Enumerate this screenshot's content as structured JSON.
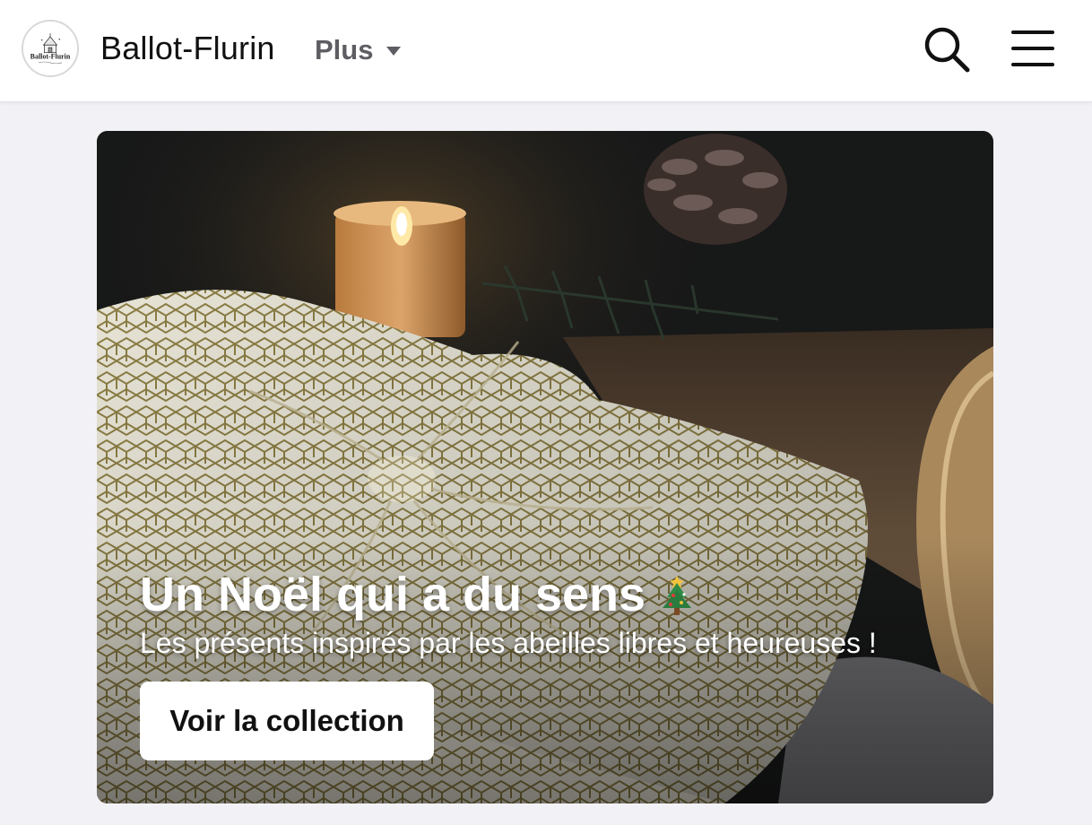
{
  "header": {
    "brand": "Ballot-Flurin",
    "logo_text": "Ballot-Flurin",
    "more_label": "Plus",
    "icons": {
      "search": "search-icon",
      "menu": "hamburger-menu-icon",
      "more": "caret-down-icon"
    }
  },
  "hero": {
    "title": "Un Noël qui a du sens",
    "title_icon": "christmas-tree-icon",
    "subtitle": "Les présents inspirés par les abeilles libres et heureuses !",
    "cta_label": "Voir la collection",
    "image_description": "gift-wrapped-in-patterned-cloth-with-candle-and-pinecone"
  },
  "colors": {
    "header_bg": "#ffffff",
    "page_bg": "#f2f2f6",
    "brand_text": "#111111",
    "more_text": "#5d5d63",
    "cta_bg": "#ffffff",
    "hero_text": "#ffffff"
  }
}
